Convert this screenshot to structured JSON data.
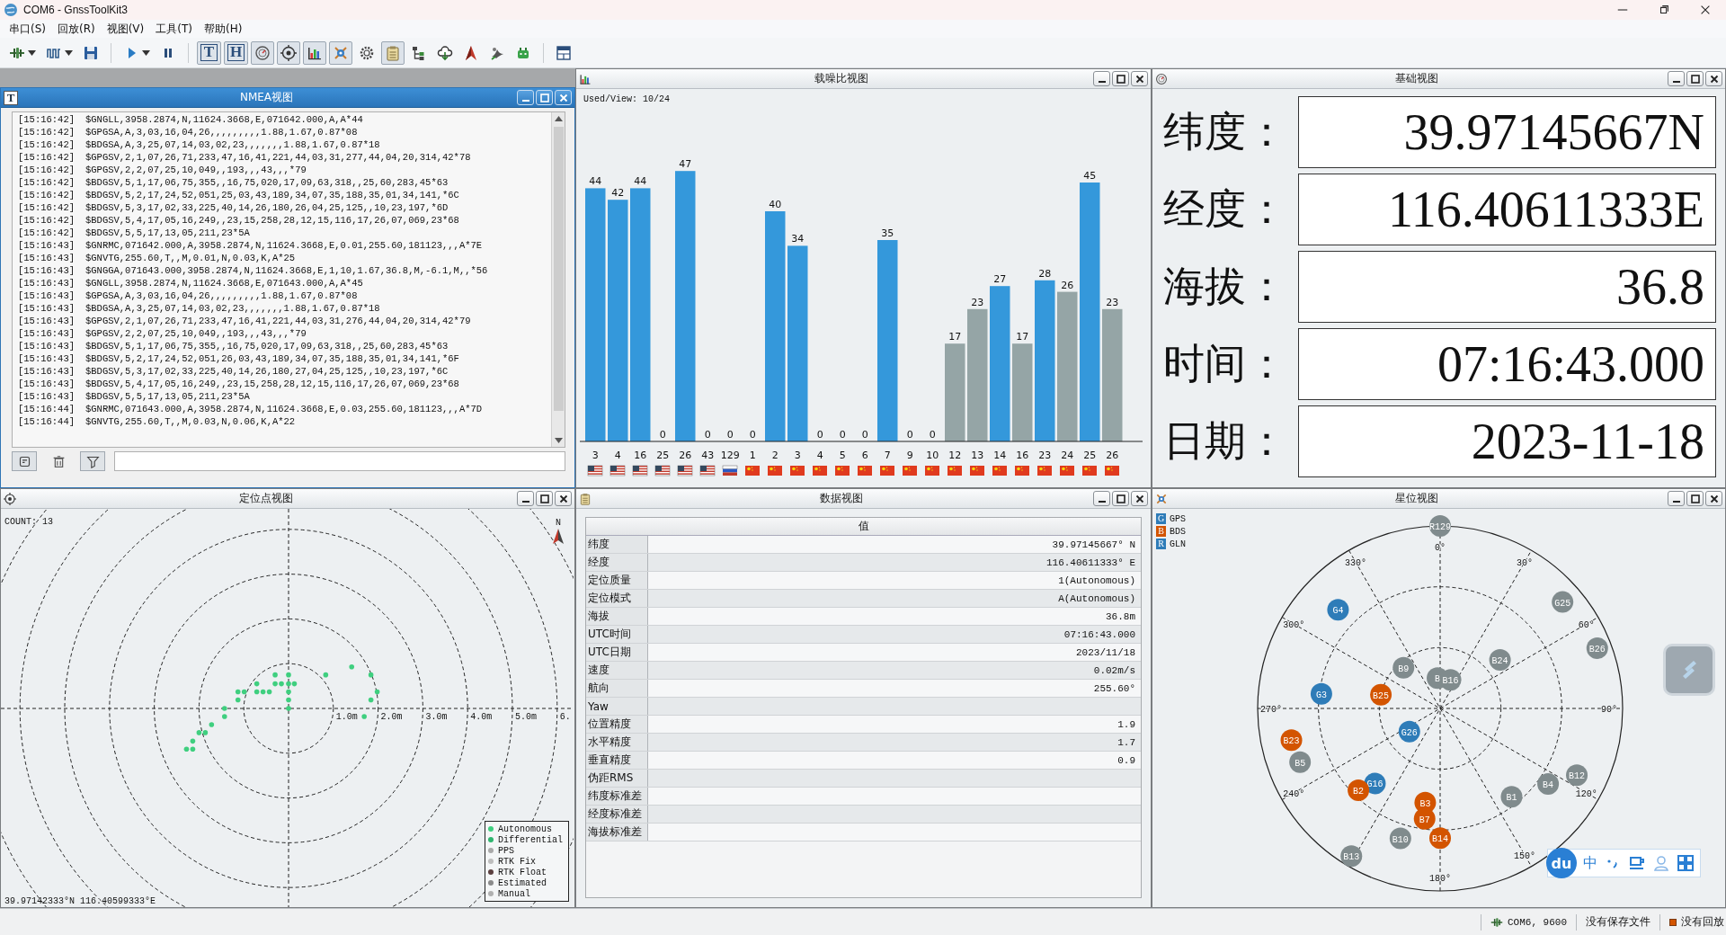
{
  "window": {
    "title": "COM6 - GnssToolKit3"
  },
  "menu": [
    "串口(S)",
    "回放(R)",
    "视图(V)",
    "工具(T)",
    "帮助(H)"
  ],
  "toolbar": [
    {
      "kind": "connect",
      "dropdown": true,
      "pressed": false
    },
    {
      "kind": "wave",
      "dropdown": true,
      "pressed": false
    },
    {
      "kind": "save",
      "dropdown": false,
      "pressed": false
    },
    {
      "kind": "separator"
    },
    {
      "kind": "play",
      "dropdown": true,
      "pressed": false
    },
    {
      "kind": "pause",
      "dropdown": false,
      "pressed": false
    },
    {
      "kind": "separator"
    },
    {
      "kind": "glyph",
      "glyph": "T",
      "dropdown": false,
      "pressed": true
    },
    {
      "kind": "glyph",
      "glyph": "H",
      "dropdown": false,
      "pressed": true
    },
    {
      "kind": "dial",
      "dropdown": false,
      "pressed": true
    },
    {
      "kind": "target",
      "dropdown": false,
      "pressed": true
    },
    {
      "kind": "bars",
      "dropdown": false,
      "pressed": true
    },
    {
      "kind": "satellite",
      "dropdown": false,
      "pressed": true
    },
    {
      "kind": "gear",
      "dropdown": false,
      "pressed": false
    },
    {
      "kind": "clipboard",
      "dropdown": false,
      "pressed": true
    },
    {
      "kind": "tree",
      "dropdown": false,
      "pressed": false
    },
    {
      "kind": "cloud",
      "dropdown": false,
      "pressed": false
    },
    {
      "kind": "arrow",
      "dropdown": false,
      "pressed": false
    },
    {
      "kind": "bird",
      "dropdown": false,
      "pressed": false
    },
    {
      "kind": "robot",
      "dropdown": false,
      "pressed": false
    },
    {
      "kind": "separator"
    },
    {
      "kind": "layout",
      "dropdown": false,
      "pressed": false
    }
  ],
  "nmea_view": {
    "title": "NMEA视图",
    "glyph": "T",
    "active": true,
    "lines": [
      {
        "time": "[15:16:42]",
        "sentence": "$GNGLL,3958.2874,N,11624.3668,E,071642.000,A,A*44"
      },
      {
        "time": "[15:16:42]",
        "sentence": "$GPGSA,A,3,03,16,04,26,,,,,,,,,1.88,1.67,0.87*08"
      },
      {
        "time": "[15:16:42]",
        "sentence": "$BDGSA,A,3,25,07,14,03,02,23,,,,,,,1.88,1.67,0.87*18"
      },
      {
        "time": "[15:16:42]",
        "sentence": "$GPGSV,2,1,07,26,71,233,47,16,41,221,44,03,31,277,44,04,20,314,42*78"
      },
      {
        "time": "[15:16:42]",
        "sentence": "$GPGSV,2,2,07,25,10,049,,193,,,43,,,*79"
      },
      {
        "time": "[15:16:42]",
        "sentence": "$BDGSV,5,1,17,06,75,355,,16,75,020,17,09,63,318,,25,60,283,45*63"
      },
      {
        "time": "[15:16:42]",
        "sentence": "$BDGSV,5,2,17,24,52,051,25,03,43,189,34,07,35,188,35,01,34,141,*6C"
      },
      {
        "time": "[15:16:42]",
        "sentence": "$BDGSV,5,3,17,02,33,225,40,14,26,180,26,04,25,125,,10,23,197,*6D"
      },
      {
        "time": "[15:16:42]",
        "sentence": "$BDGSV,5,4,17,05,16,249,,23,15,258,28,12,15,116,17,26,07,069,23*68"
      },
      {
        "time": "[15:16:42]",
        "sentence": "$BDGSV,5,5,17,13,05,211,23*5A"
      },
      {
        "time": "[15:16:43]",
        "sentence": "$GNRMC,071642.000,A,3958.2874,N,11624.3668,E,0.01,255.60,181123,,,A*7E"
      },
      {
        "time": "[15:16:43]",
        "sentence": "$GNVTG,255.60,T,,M,0.01,N,0.03,K,A*25"
      },
      {
        "time": "[15:16:43]",
        "sentence": "$GNGGA,071643.000,3958.2874,N,11624.3668,E,1,10,1.67,36.8,M,-6.1,M,,*56"
      },
      {
        "time": "[15:16:43]",
        "sentence": "$GNGLL,3958.2874,N,11624.3668,E,071643.000,A,A*45"
      },
      {
        "time": "[15:16:43]",
        "sentence": "$GPGSA,A,3,03,16,04,26,,,,,,,,,1.88,1.67,0.87*08"
      },
      {
        "time": "[15:16:43]",
        "sentence": "$BDGSA,A,3,25,07,14,03,02,23,,,,,,,1.88,1.67,0.87*18"
      },
      {
        "time": "[15:16:43]",
        "sentence": "$GPGSV,2,1,07,26,71,233,47,16,41,221,44,03,31,276,44,04,20,314,42*79"
      },
      {
        "time": "[15:16:43]",
        "sentence": "$GPGSV,2,2,07,25,10,049,,193,,,43,,,*79"
      },
      {
        "time": "[15:16:43]",
        "sentence": "$BDGSV,5,1,17,06,75,355,,16,75,020,17,09,63,318,,25,60,283,45*63"
      },
      {
        "time": "[15:16:43]",
        "sentence": "$BDGSV,5,2,17,24,52,051,26,03,43,189,34,07,35,188,35,01,34,141,*6F"
      },
      {
        "time": "[15:16:43]",
        "sentence": "$BDGSV,5,3,17,02,33,225,40,14,26,180,27,04,25,125,,10,23,197,*6C"
      },
      {
        "time": "[15:16:43]",
        "sentence": "$BDGSV,5,4,17,05,16,249,,23,15,258,28,12,15,116,17,26,07,069,23*68"
      },
      {
        "time": "[15:16:43]",
        "sentence": "$BDGSV,5,5,17,13,05,211,23*5A"
      },
      {
        "time": "[15:16:44]",
        "sentence": "$GNRMC,071643.000,A,3958.2874,N,11624.3668,E,0.03,255.60,181123,,,A*7D"
      },
      {
        "time": "[15:16:44]",
        "sentence": "$GNVTG,255.60,T,,M,0.03,N,0.06,K,A*22"
      }
    ],
    "tools": [
      {
        "kind": "log",
        "pressed": true
      },
      {
        "kind": "trash",
        "pressed": false
      },
      {
        "kind": "filter",
        "pressed": true
      }
    ]
  },
  "snr_view": {
    "title": "载噪比视图",
    "active": false,
    "used_view": "Used/View: 10/24",
    "chart_data": {
      "type": "bar",
      "categories": [
        "3",
        "4",
        "16",
        "25",
        "26",
        "43",
        "129",
        "1",
        "2",
        "3",
        "4",
        "5",
        "6",
        "7",
        "9",
        "10",
        "12",
        "13",
        "14",
        "16",
        "23",
        "24",
        "25",
        "26"
      ],
      "values": [
        44,
        42,
        44,
        0,
        47,
        0,
        0,
        0,
        40,
        34,
        0,
        0,
        0,
        35,
        0,
        0,
        17,
        23,
        27,
        17,
        28,
        26,
        45,
        23
      ],
      "data_labels": true
    },
    "satellites": [
      {
        "kind": "gps",
        "used": true
      },
      {
        "kind": "gps",
        "used": true
      },
      {
        "kind": "gps",
        "used": true
      },
      {
        "kind": "gps"
      },
      {
        "kind": "gps",
        "used": true
      },
      {
        "kind": "gps"
      },
      {
        "kind": "glonass"
      },
      {
        "kind": "bds"
      },
      {
        "kind": "bds",
        "used": true
      },
      {
        "kind": "bds",
        "used": true
      },
      {
        "kind": "bds"
      },
      {
        "kind": "bds"
      },
      {
        "kind": "bds"
      },
      {
        "kind": "bds",
        "used": true
      },
      {
        "kind": "bds"
      },
      {
        "kind": "bds"
      },
      {
        "kind": "bds",
        "used": false
      },
      {
        "kind": "bds",
        "used": false
      },
      {
        "kind": "bds",
        "used": true
      },
      {
        "kind": "bds",
        "used": false
      },
      {
        "kind": "bds",
        "used": true
      },
      {
        "kind": "bds",
        "used": false
      },
      {
        "kind": "bds",
        "used": true
      },
      {
        "kind": "bds",
        "used": false
      }
    ]
  },
  "basic_view": {
    "title": "基础视图",
    "active": false,
    "rows": [
      {
        "label": "纬度：",
        "value": "39.97145667N"
      },
      {
        "label": "经度：",
        "value": "116.40611333E"
      },
      {
        "label": "海拔：",
        "value": "36.8"
      },
      {
        "label": "时间：",
        "value": "07:16:43.000"
      },
      {
        "label": "日期：",
        "value": "2023-11-18"
      }
    ]
  },
  "position_view": {
    "title": "定位点视图",
    "active": false,
    "count": "COUNT: 13",
    "coordinates": "39.97142333°N 116.40599333°E",
    "north": "N",
    "scale_labels": [
      "1.0m",
      "2.0m",
      "3.0m",
      "4.0m",
      "5.0m",
      "6."
    ],
    "legend": [
      {
        "label": "Autonomous",
        "color": "#3fcf7f"
      },
      {
        "label": "Differential",
        "color": "#2fb56f"
      },
      {
        "label": "PPS",
        "color": "#a9a9a9"
      },
      {
        "label": "RTK Fix",
        "color": "#bdbdbd"
      },
      {
        "label": "RTK Float",
        "color": "#5b4040"
      },
      {
        "label": "Estimated",
        "color": "#8a8a8a"
      },
      {
        "label": "Manual",
        "color": "#b0b0b0"
      }
    ]
  },
  "data_view": {
    "title": "数据视图",
    "active": false,
    "header": "值",
    "rows": [
      {
        "label": "纬度",
        "value": "39.97145667° N"
      },
      {
        "label": "经度",
        "value": "116.40611333° E"
      },
      {
        "label": "定位质量",
        "value": "1(Autonomous)"
      },
      {
        "label": "定位模式",
        "value": "A(Autonomous)"
      },
      {
        "label": "海拔",
        "value": "36.8m"
      },
      {
        "label": "UTC时间",
        "value": "07:16:43.000"
      },
      {
        "label": "UTC日期",
        "value": "2023/11/18"
      },
      {
        "label": "速度",
        "value": "0.02m/s"
      },
      {
        "label": "航向",
        "value": "255.60° "
      },
      {
        "label": "Yaw"
      },
      {
        "label": "位置精度",
        "value": "1.9"
      },
      {
        "label": "水平精度",
        "value": "1.7"
      },
      {
        "label": "垂直精度",
        "value": "0.9"
      },
      {
        "label": "伪距RMS"
      },
      {
        "label": "纬度标准差"
      },
      {
        "label": "经度标准差"
      },
      {
        "label": "海拔标准差"
      }
    ]
  },
  "sky_view": {
    "title": "星位视图",
    "active": false,
    "legend": [
      {
        "letter": "G",
        "name": "GPS",
        "color": "#2e7cb8"
      },
      {
        "letter": "B",
        "name": "BDS",
        "color": "#d35400"
      },
      {
        "letter": "R",
        "name": "GLN",
        "color": "#2e7cb8"
      }
    ],
    "angle_labels": [
      "0°",
      "30°",
      "60°",
      "90°",
      "120°",
      "150°",
      "180°",
      "240°",
      "270°",
      "300°",
      "330°"
    ],
    "satellites": [
      {
        "label": "R129",
        "color": "#808b8d"
      },
      {
        "label": "G4",
        "color": "#2e7cb8"
      },
      {
        "label": "G25",
        "color": "#808b8d"
      },
      {
        "label": "B26",
        "color": "#808b8d"
      },
      {
        "label": "B24",
        "color": "#808b8d"
      },
      {
        "label": "B9",
        "color": "#808b8d"
      },
      {
        "label": "B",
        "color": "#808b8d"
      },
      {
        "label": "B16",
        "color": "#808b8d"
      },
      {
        "label": "G3",
        "color": "#2e7cb8"
      },
      {
        "label": "B25",
        "color": "#d35400"
      },
      {
        "label": "G26",
        "color": "#2e7cb8"
      },
      {
        "label": "B23",
        "color": "#d35400"
      },
      {
        "label": "B5",
        "color": "#808b8d"
      },
      {
        "label": "G16",
        "color": "#2e7cb8"
      },
      {
        "label": "B2",
        "color": "#d35400"
      },
      {
        "label": "B3",
        "color": "#d35400"
      },
      {
        "label": "B7",
        "color": "#d35400"
      },
      {
        "label": "B14",
        "color": "#d35400"
      },
      {
        "label": "B10",
        "color": "#808b8d"
      },
      {
        "label": "B13",
        "color": "#808b8d"
      },
      {
        "label": "B1",
        "color": "#808b8d"
      },
      {
        "label": "B4",
        "color": "#808b8d"
      },
      {
        "label": "B12",
        "color": "#808b8d"
      }
    ]
  },
  "ime_toolbar": {
    "logo": "du",
    "mode": "中"
  },
  "status_bar": {
    "connection": "COM6, 9600",
    "save": "没有保存文件",
    "playback": "没有回放"
  }
}
